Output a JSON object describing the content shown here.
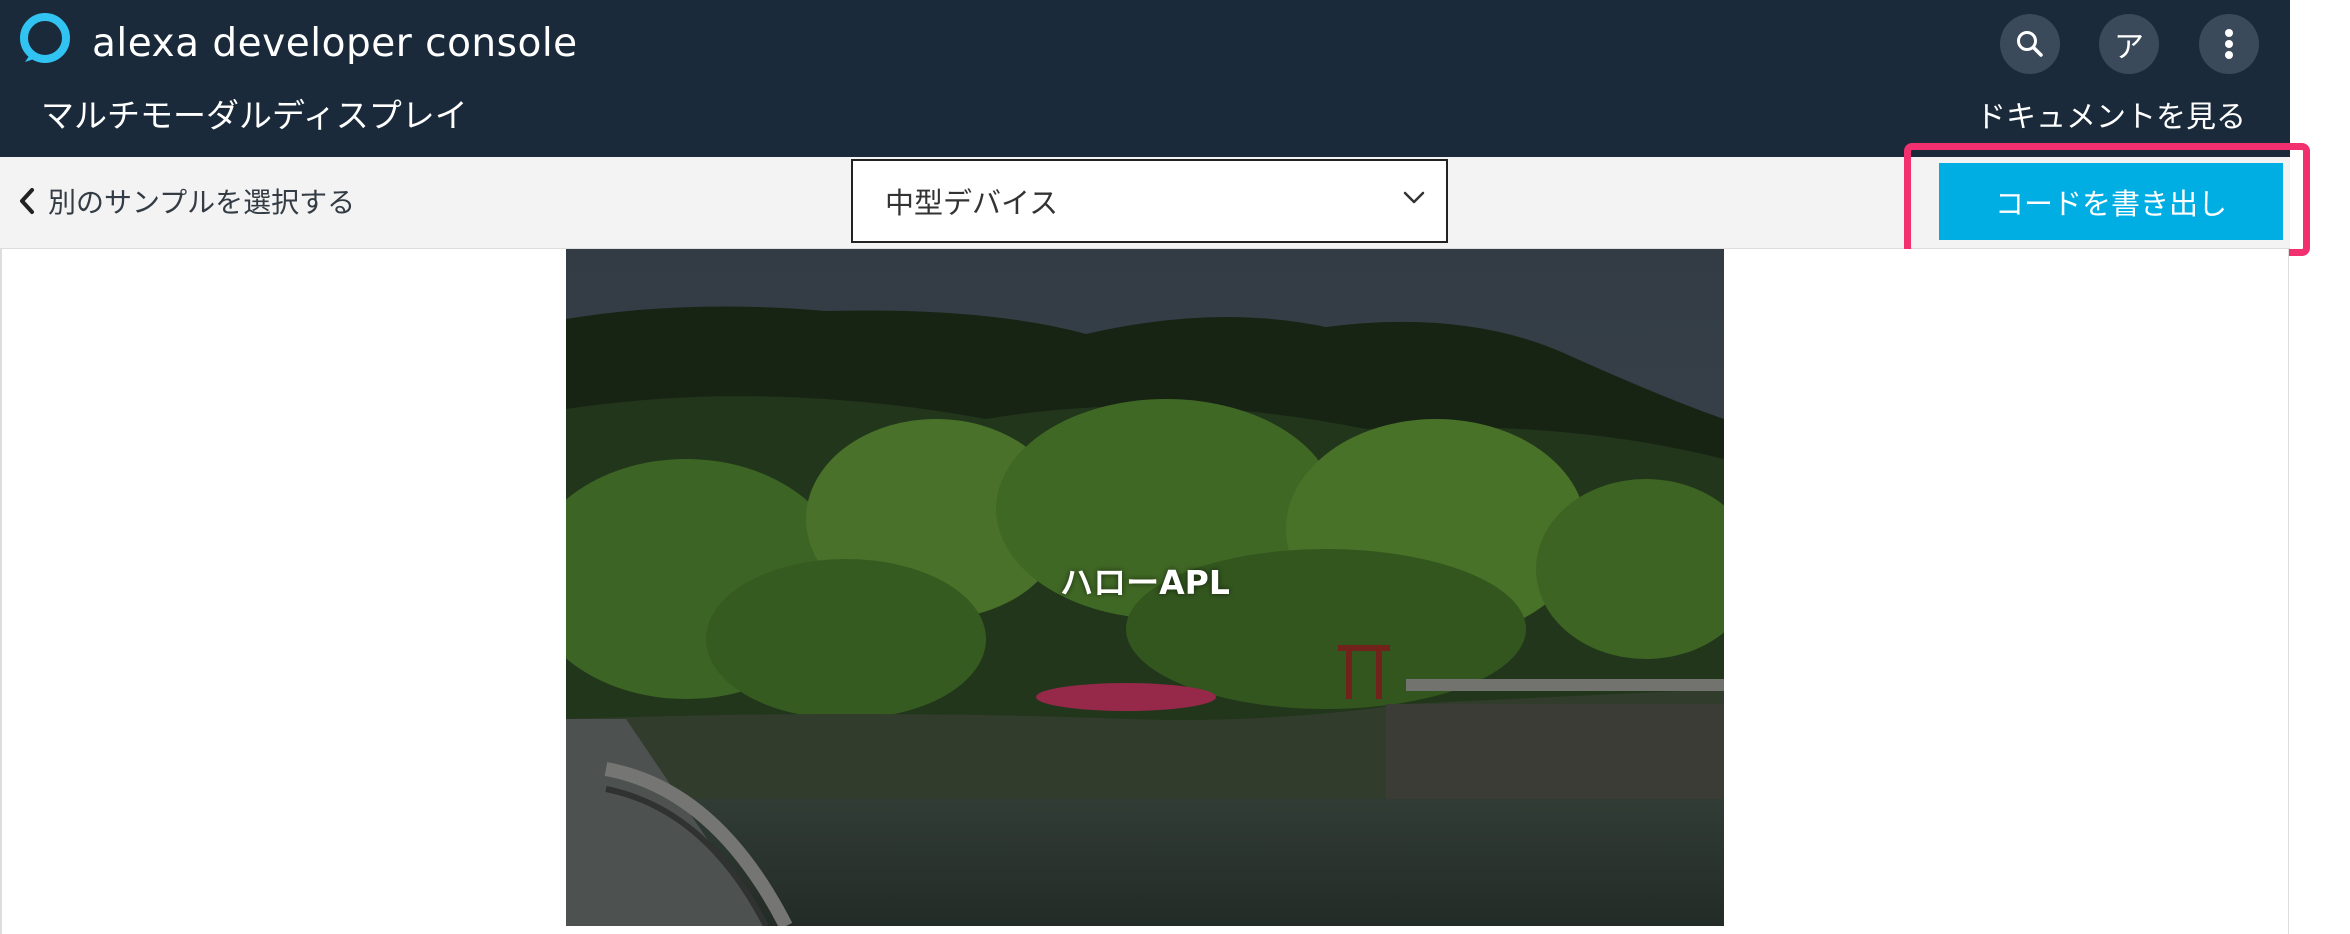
{
  "header": {
    "brand": "alexa developer console",
    "page_title": "マルチモーダルディスプレイ",
    "docs_link": "ドキュメントを見る",
    "avatar_initial": "ア",
    "icons": [
      "alexa-logo-icon",
      "search-icon",
      "more-vertical-icon"
    ],
    "background_color": "#1a2a3a"
  },
  "toolbar": {
    "back_label": "別のサンプルを選択する",
    "device_select": {
      "selected": "中型デバイス"
    },
    "export_button": "コードを書き出し",
    "export_color": "#00aee3",
    "highlight_color": "#f2306f"
  },
  "preview": {
    "text": "ハローAPL"
  }
}
